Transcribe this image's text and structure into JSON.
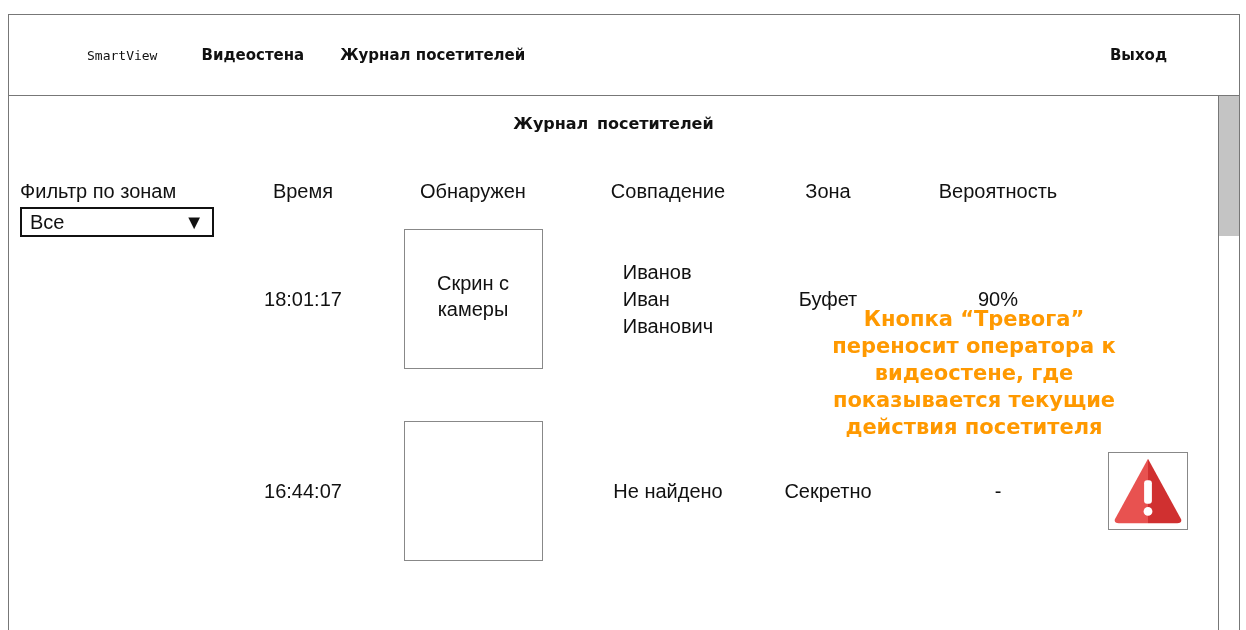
{
  "nav": {
    "brand": "SmartView",
    "links": [
      "Видеостена",
      "Журнал посетителей"
    ],
    "exit": "Выход"
  },
  "title": "Журнал посетителей",
  "filter": {
    "label": "Фильтр по зонам",
    "value": "Все",
    "arrow": "▼"
  },
  "columns": [
    "Время",
    "Обнаружен",
    "Совпадение",
    "Зона",
    "Вероятность"
  ],
  "rows": [
    {
      "time": "18:01:17",
      "detected": "Скрин с камеры",
      "match": "Иванов\nИван\nИванович",
      "zone": "Буфет",
      "probability": "90%",
      "alarm": false
    },
    {
      "time": "16:44:07",
      "match": "Не найдено",
      "zone": "Секретно",
      "probability": "-",
      "alarm": true
    }
  ],
  "note": "Кнопка “Тревога” переносит оператора к видеостене, где показывается текущие действия посетителя"
}
